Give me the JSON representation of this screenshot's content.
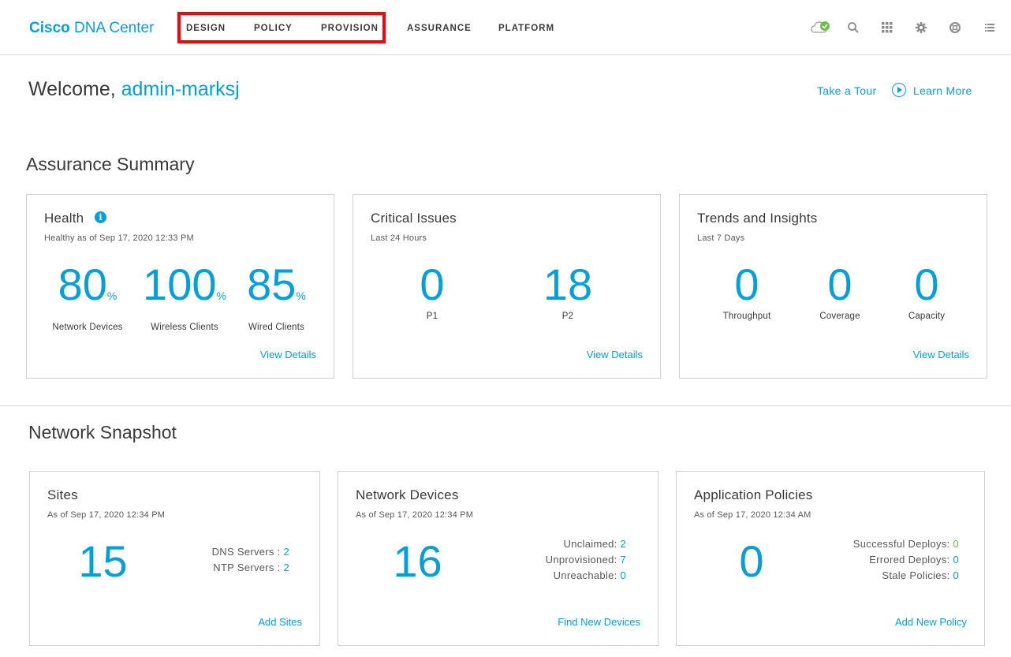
{
  "header": {
    "logo_bold": "Cisco",
    "logo_rest": " DNA Center",
    "nav": [
      "DESIGN",
      "POLICY",
      "PROVISION",
      "ASSURANCE",
      "PLATFORM"
    ]
  },
  "welcome": {
    "greeting": "Welcome, ",
    "user": "admin-marksj",
    "tour": "Take a Tour",
    "learn": "Learn More"
  },
  "assurance": {
    "title": "Assurance Summary",
    "health": {
      "title": "Health",
      "subtitle": "Healthy as of Sep 17, 2020 12:33 PM",
      "metrics": [
        {
          "value": "80",
          "unit": "%",
          "label": "Network Devices"
        },
        {
          "value": "100",
          "unit": "%",
          "label": "Wireless Clients"
        },
        {
          "value": "85",
          "unit": "%",
          "label": "Wired Clients"
        }
      ],
      "link": "View Details"
    },
    "critical": {
      "title": "Critical Issues",
      "subtitle": "Last 24 Hours",
      "metrics": [
        {
          "value": "0",
          "label": "P1"
        },
        {
          "value": "18",
          "label": "P2"
        }
      ],
      "link": "View Details"
    },
    "trends": {
      "title": "Trends and Insights",
      "subtitle": "Last 7 Days",
      "metrics": [
        {
          "value": "0",
          "label": "Throughput"
        },
        {
          "value": "0",
          "label": "Coverage"
        },
        {
          "value": "0",
          "label": "Capacity"
        }
      ],
      "link": "View Details"
    }
  },
  "snapshot": {
    "title": "Network Snapshot",
    "sites": {
      "title": "Sites",
      "subtitle": "As of Sep 17, 2020 12:34 PM",
      "value": "15",
      "rows": [
        {
          "label": "DNS Servers :",
          "value": "2"
        },
        {
          "label": "NTP Servers :",
          "value": "2"
        }
      ],
      "link": "Add Sites"
    },
    "devices": {
      "title": "Network Devices",
      "subtitle": "As of Sep 17, 2020 12:34 PM",
      "value": "16",
      "rows": [
        {
          "label": "Unclaimed:",
          "value": "2"
        },
        {
          "label": "Unprovisioned:",
          "value": "7"
        },
        {
          "label": "Unreachable:",
          "value": "0"
        }
      ],
      "link": "Find New Devices"
    },
    "policies": {
      "title": "Application Policies",
      "subtitle": "As of Sep 17, 2020 12:34 AM",
      "value": "0",
      "rows": [
        {
          "label": "Successful Deploys:",
          "value": "0"
        },
        {
          "label": "Errored Deploys:",
          "value": "0"
        },
        {
          "label": "Stale Policies:",
          "value": "0"
        }
      ],
      "link": "Add New Policy"
    }
  },
  "icons": [
    "cloud-status-icon",
    "search-icon",
    "apps-grid-icon",
    "gear-icon",
    "help-globe-icon",
    "list-icon"
  ],
  "colors": {
    "accent": "#049fd9",
    "success": "#6cc04a",
    "highlight": "#ff0000"
  }
}
